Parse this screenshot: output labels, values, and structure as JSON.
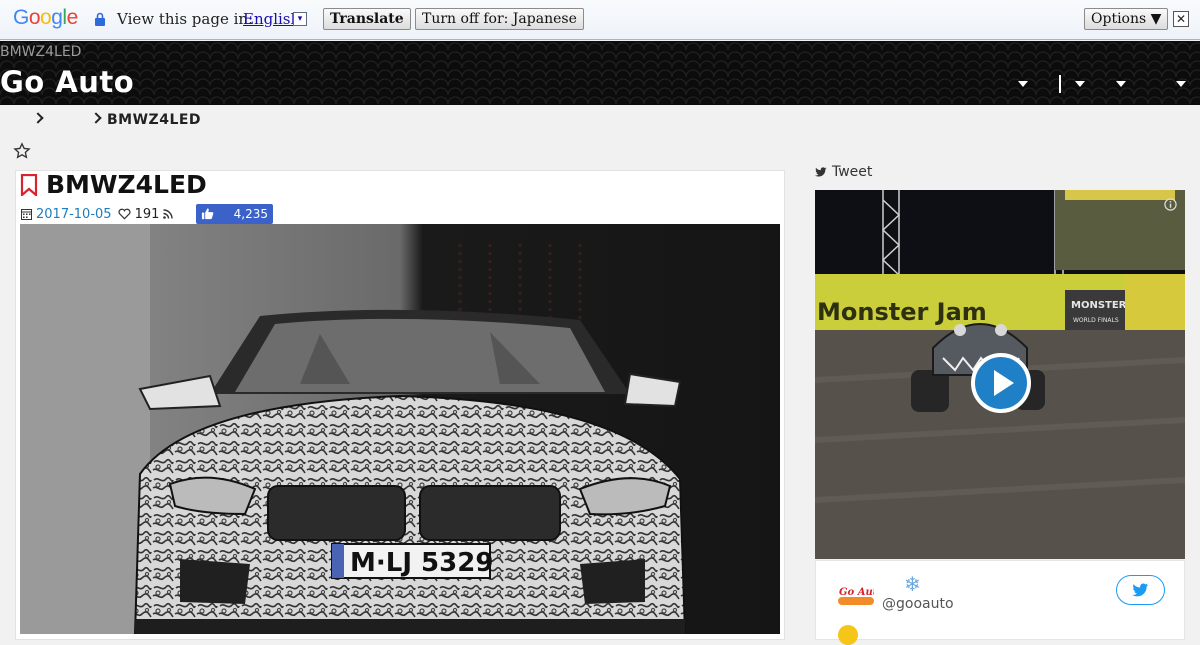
{
  "translate_bar": {
    "logo": "Google",
    "label": "View this page in:",
    "language": "English",
    "caret": "▾",
    "translate_button": "Translate",
    "turn_off_button": "Turn off for: Japanese",
    "options_button": "Options ▼",
    "close": "✕"
  },
  "header": {
    "subtitle": "BMWZ4LED",
    "title": "Go Auto"
  },
  "breadcrumb": {
    "current": "BMWZ4LED"
  },
  "article": {
    "title": "BMWZ4LED",
    "date": "2017-10-05",
    "favorites": "191",
    "likes": "4,235"
  },
  "sidebar": {
    "tweet_label": "Tweet",
    "twitter_handle": "@gooauto",
    "logo_text": "Go Auto",
    "snow": "❄"
  },
  "photo": {
    "plate": "M·LJ 5329"
  },
  "video": {
    "banner": "Monster Jam",
    "logo": "MONSTER JAM",
    "logo_sub": "WORLD FINALS"
  },
  "colors": {
    "header_bg": "#0c0c0c",
    "link": "#1f7cbf",
    "like_button": "#3b62c9",
    "twitter": "#1d9bf0",
    "bookmark": "#d9232e"
  }
}
